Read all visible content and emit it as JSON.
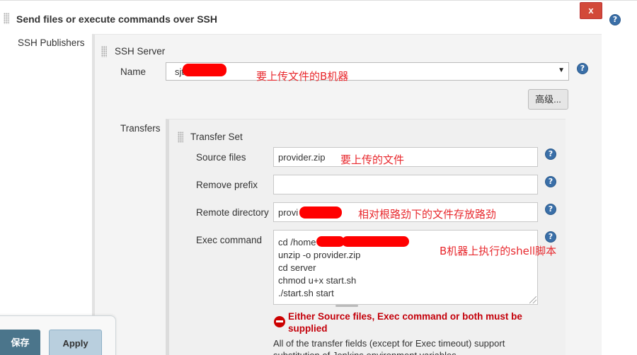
{
  "section": {
    "title": "Send files or execute commands over SSH",
    "close_label": "x"
  },
  "help_glyph": "?",
  "ssh_publishers_label": "SSH Publishers",
  "ssh_server": {
    "title": "SSH Server",
    "name_label": "Name",
    "name_value": "sjt",
    "advanced_label": "高级..."
  },
  "transfers_label": "Transfers",
  "transfer_set": {
    "title": "Transfer Set",
    "source_files_label": "Source files",
    "source_files_value": "provider.zip",
    "remove_prefix_label": "Remove prefix",
    "remove_prefix_value": "",
    "remote_directory_label": "Remote directory",
    "remote_directory_value": "provi",
    "exec_command_label": "Exec command",
    "exec_command_lines": [
      "cd /home",
      "unzip -o provider.zip",
      "cd server",
      "chmod u+x start.sh",
      "./start.sh start"
    ]
  },
  "error_message": "Either Source files, Exec command or both must be supplied",
  "info_text": "All of the transfer fields (except for Exec timeout) support substitution of Jenkins environment variables",
  "annotations": {
    "name": "要上传文件的B机器",
    "source": "要上传的文件",
    "remote": "相对根路劲下的文件存放路劲",
    "exec": "B机器上执行的shell脚本"
  },
  "buttons": {
    "save": "保存",
    "apply": "Apply"
  },
  "colors": {
    "annotation": "#e8282d",
    "redaction": "#ff0000",
    "error": "#c4000a",
    "save_button": "#4b758b",
    "close_button": "#d24939"
  }
}
